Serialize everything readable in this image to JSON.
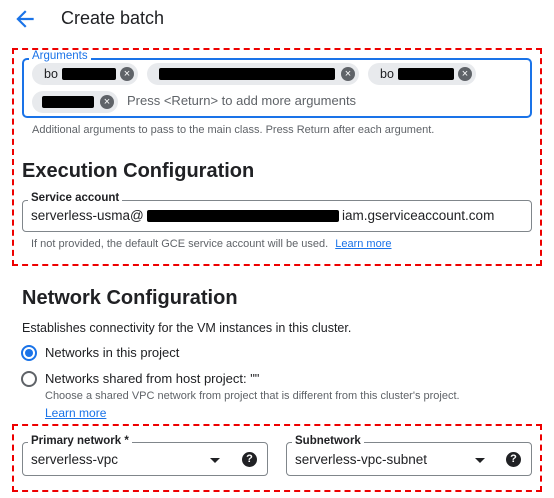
{
  "header": {
    "title": "Create batch",
    "back_icon": "arrow-back-icon"
  },
  "arguments": {
    "label": "Arguments",
    "chips": [
      {
        "text": "bo"
      },
      {
        "text": ""
      },
      {
        "text": "bo"
      },
      {
        "text": ""
      }
    ],
    "placeholder": "Press <Return> to add more arguments",
    "helper": "Additional arguments to pass to the main class. Press Return after each argument."
  },
  "execution": {
    "title": "Execution Configuration",
    "service_account_label": "Service account",
    "service_account_prefix": "serverless-usma@",
    "service_account_suffix": "iam.gserviceaccount.com",
    "helper": "If not provided, the default GCE service account will be used.",
    "learn_more": "Learn more"
  },
  "network": {
    "title": "Network Configuration",
    "description": "Establishes connectivity for the VM instances in this cluster.",
    "options": [
      {
        "label": "Networks in this project",
        "selected": true
      },
      {
        "label": "Networks shared from host project: \"\"",
        "selected": false
      }
    ],
    "shared_helper": "Choose a shared VPC network from project that is different from this cluster's project.",
    "learn_more": "Learn more",
    "primary_network": {
      "label": "Primary network *",
      "value": "serverless-vpc"
    },
    "subnetwork": {
      "label": "Subnetwork",
      "value": "serverless-vpc-subnet"
    }
  },
  "colors": {
    "accent": "#1a73e8",
    "annotation_red": "#ee0000"
  }
}
